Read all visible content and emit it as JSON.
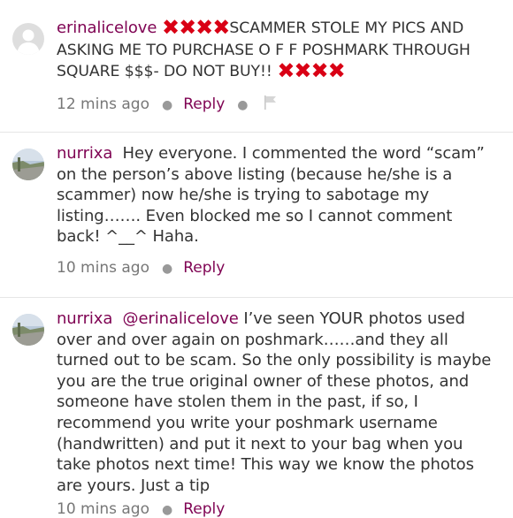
{
  "comments": [
    {
      "username": "erinalicelove",
      "x_marks": "✖✖✖✖",
      "text": "SCAMMER STOLE MY PICS AND ASKING ME TO PURCHASE O F F  POSHMARK THROUGH SQUARE $$$- DO NOT BUY!!",
      "time": "12 mins ago",
      "reply": "Reply",
      "icons": [
        "default-avatar-icon",
        "flag-icon"
      ]
    },
    {
      "username": "nurrixa",
      "text": "Hey everyone. I commented the word “scam” on the person’s above listing (because he/she is a scammer) now he/she is trying to sabotage my listing……. Even blocked me so I cannot comment back! ^__^ Haha.",
      "time": "10 mins ago",
      "reply": "Reply",
      "icons": [
        "profile-photo-avatar"
      ]
    },
    {
      "username": "nurrixa",
      "mention": "@erinalicelove",
      "text": "I’ve seen YOUR photos used over and over again on poshmark……and they all turned out to be scam. So the only possibility is maybe you are the true original owner of these photos, and someone have stolen them in the past, if so, I recommend you write your poshmark username (handwritten) and put it next to your bag when you take photos next time! This way we know the photos are yours. Just a tip",
      "time": "10 mins ago",
      "reply": "Reply",
      "icons": [
        "profile-photo-avatar"
      ]
    }
  ],
  "colors": {
    "username": "#7f0353",
    "x_mark": "#d90015",
    "meta": "#777777"
  }
}
